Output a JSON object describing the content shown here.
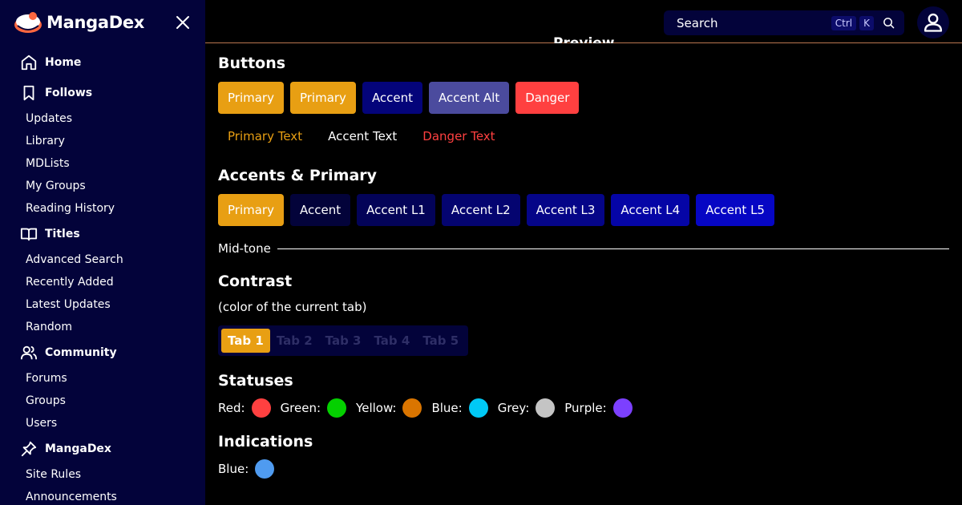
{
  "sidebar": {
    "brand": "MangaDex",
    "sections": [
      {
        "label": "Home",
        "icon": "home-icon",
        "items": []
      },
      {
        "label": "Follows",
        "icon": "bookmark-icon",
        "items": [
          "Updates",
          "Library",
          "MDLists",
          "My Groups",
          "Reading History"
        ]
      },
      {
        "label": "Titles",
        "icon": "book-open-icon",
        "items": [
          "Advanced Search",
          "Recently Added",
          "Latest Updates",
          "Random"
        ]
      },
      {
        "label": "Community",
        "icon": "users-icon",
        "items": [
          "Forums",
          "Groups",
          "Users"
        ]
      },
      {
        "label": "MangaDex",
        "icon": "pin-icon",
        "items": [
          "Site Rules",
          "Announcements"
        ]
      }
    ]
  },
  "topbar": {
    "search_placeholder": "Search",
    "kbd_ctrl": "Ctrl",
    "kbd_k": "K"
  },
  "preview_label": "Preview",
  "buttons": {
    "title": "Buttons",
    "solid": [
      {
        "label": "Primary",
        "color": "#e89f13"
      },
      {
        "label": "Primary",
        "color": "#e89f13"
      },
      {
        "label": "Accent",
        "color": "#04047a"
      },
      {
        "label": "Accent Alt",
        "color": "#4b4b9e"
      },
      {
        "label": "Danger",
        "color": "#ff4040"
      }
    ],
    "text": [
      {
        "label": "Primary Text",
        "color": "#e89f13"
      },
      {
        "label": "Accent Text",
        "color": "#ffffff"
      },
      {
        "label": "Danger Text",
        "color": "#ff4040"
      }
    ]
  },
  "accents": {
    "title": "Accents & Primary",
    "items": [
      {
        "label": "Primary",
        "color": "#e89f13"
      },
      {
        "label": "Accent",
        "color": "#03033a"
      },
      {
        "label": "Accent L1",
        "color": "#030358"
      },
      {
        "label": "Accent L2",
        "color": "#040470"
      },
      {
        "label": "Accent L3",
        "color": "#050588"
      },
      {
        "label": "Accent L4",
        "color": "#0505a6"
      },
      {
        "label": "Accent L5",
        "color": "#0606c4"
      }
    ]
  },
  "midtone": "Mid-tone",
  "contrast": {
    "title": "Contrast",
    "subtitle": "(color of the current tab)",
    "tabs": [
      "Tab 1",
      "Tab 2",
      "Tab 3",
      "Tab 4",
      "Tab 5"
    ],
    "active_index": 0
  },
  "statuses": {
    "title": "Statuses",
    "items": [
      {
        "label": "Red:",
        "color": "#ff4040"
      },
      {
        "label": "Green:",
        "color": "#04d000"
      },
      {
        "label": "Yellow:",
        "color": "#da7500"
      },
      {
        "label": "Blue:",
        "color": "#00c9f5"
      },
      {
        "label": "Grey:",
        "color": "#c4c4c4"
      },
      {
        "label": "Purple:",
        "color": "#7c40ff"
      }
    ]
  },
  "indications": {
    "title": "Indications",
    "items": [
      {
        "label": "Blue:",
        "color": "#4f9bf0"
      }
    ]
  }
}
